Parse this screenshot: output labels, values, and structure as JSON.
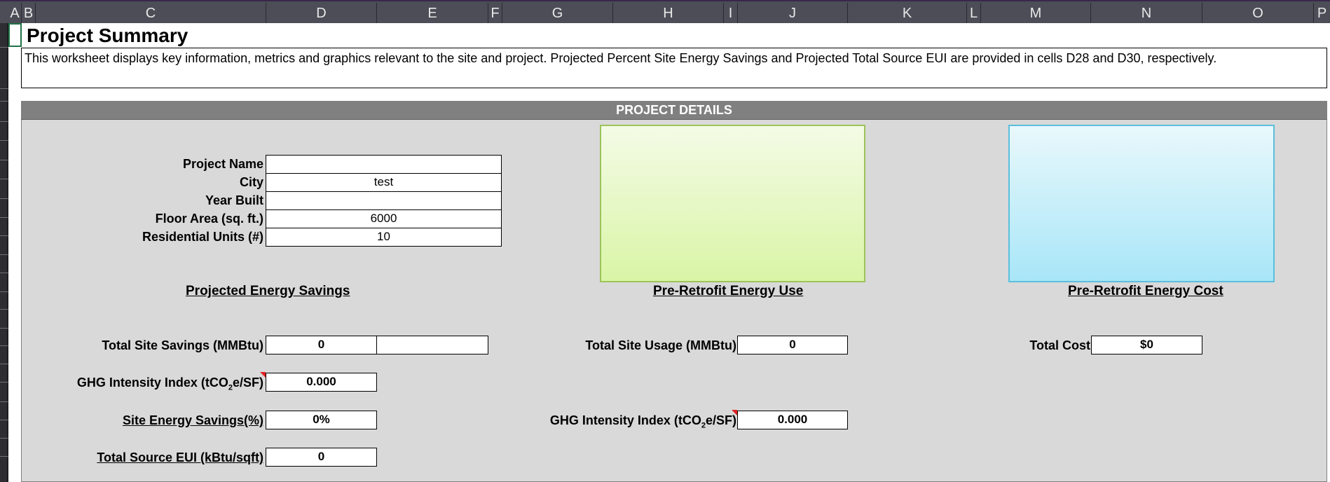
{
  "columns": [
    "A",
    "B",
    "C",
    "D",
    "E",
    "F",
    "G",
    "H",
    "I",
    "J",
    "K",
    "L",
    "M",
    "N",
    "O",
    "P"
  ],
  "sheet": {
    "title": "Project Summary",
    "description": "This worksheet displays key information, metrics and graphics relevant to the site and project. Projected Percent Site Energy Savings and Projected Total Source EUI are provided in cells D28 and D30, respectively."
  },
  "panel": {
    "header": "PROJECT DETAILS",
    "project_info": [
      {
        "label": "Project Name",
        "value": ""
      },
      {
        "label": "City",
        "value": "test"
      },
      {
        "label": "Year Built",
        "value": ""
      },
      {
        "label": "Floor Area (sq. ft.)",
        "value": "6000"
      },
      {
        "label": "Residential Units (#)",
        "value": "10"
      }
    ],
    "sections": {
      "savings": "Projected Energy Savings",
      "use": "Pre-Retrofit Energy Use",
      "cost": "Pre-Retrofit Energy Cost"
    },
    "savings": {
      "total_site_label": "Total Site Savings (MMBtu)",
      "total_site_value": "0",
      "ghg_label_pre": "GHG Intensity Index (tCO",
      "ghg_label_sub": "2",
      "ghg_label_post": "e/SF)",
      "ghg_value": "0.000",
      "site_pct_label": "Site Energy Savings(%)",
      "site_pct_value": "0%",
      "source_eui_label": "Total Source EUI (kBtu/sqft)",
      "source_eui_value": "0"
    },
    "usage": {
      "total_site_label": "Total Site Usage (MMBtu)",
      "total_site_value": "0",
      "ghg_label_pre": "GHG Intensity Index (tCO",
      "ghg_label_sub": "2",
      "ghg_label_post": "e/SF)",
      "ghg_value": "0.000"
    },
    "cost": {
      "total_label": "Total Cost",
      "total_value": "$0"
    }
  },
  "colors": {
    "header_bar": "#808080",
    "panel": "#d9d9d9",
    "chart_use": "#d9f5a6",
    "chart_cost": "#a8e6f7",
    "selection": "#217346"
  }
}
